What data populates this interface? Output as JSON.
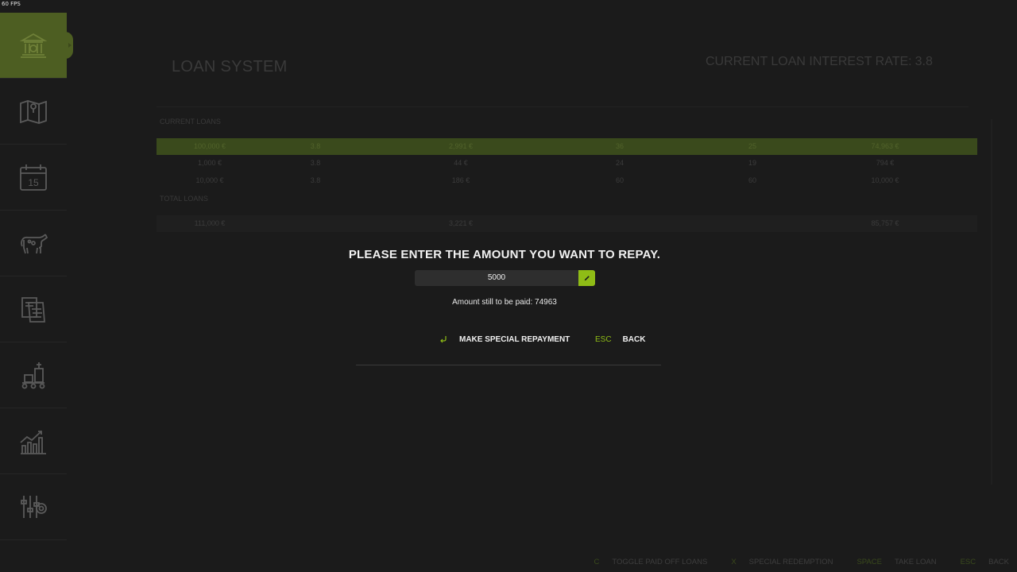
{
  "fps": "60 FPS",
  "sidebar": {
    "items": [
      {
        "icon": "bank-icon",
        "active": true
      },
      {
        "icon": "map-icon",
        "active": false
      },
      {
        "icon": "calendar-icon",
        "active": false
      },
      {
        "icon": "cow-icon",
        "active": false
      },
      {
        "icon": "documents-icon",
        "active": false
      },
      {
        "icon": "production-icon",
        "active": false
      },
      {
        "icon": "statistics-icon",
        "active": false
      },
      {
        "icon": "settings-icon",
        "active": false
      }
    ],
    "calendar_day": "15"
  },
  "page": {
    "title": "LOAN SYSTEM",
    "rate_label": "CURRENT LOAN INTEREST RATE:",
    "rate_value": "3.8",
    "current_loans_label": "CURRENT LOANS",
    "total_loans_label": "TOTAL LOANS",
    "loans": [
      [
        "100,000 €",
        "3.8",
        "2,991 €",
        "36",
        "25",
        "74,963 €"
      ],
      [
        "1,000 €",
        "3.8",
        "44 €",
        "24",
        "19",
        "794 €"
      ],
      [
        "10,000 €",
        "3.8",
        "186 €",
        "60",
        "60",
        "10,000 €"
      ]
    ],
    "totals": {
      "amount": "111,000 €",
      "installment": "3,221 €",
      "remaining": "85,757 €"
    }
  },
  "dialog": {
    "title": "PLEASE ENTER THE AMOUNT YOU WANT TO REPAY.",
    "amount_value": "5000",
    "remaining_text": "Amount still to be paid: 74963",
    "repay_label": "MAKE SPECIAL REPAYMENT",
    "back_key": "ESC",
    "back_label": "BACK"
  },
  "footer": [
    {
      "key": "C",
      "label": "TOGGLE PAID OFF LOANS"
    },
    {
      "key": "X",
      "label": "SPECIAL REDEMPTION"
    },
    {
      "key": "SPACE",
      "label": "TAKE LOAN"
    },
    {
      "key": "ESC",
      "label": "BACK"
    }
  ],
  "colors": {
    "accent": "#8fbc16",
    "background": "#1b1b1b",
    "highlight_row": "#3a4a1c"
  }
}
